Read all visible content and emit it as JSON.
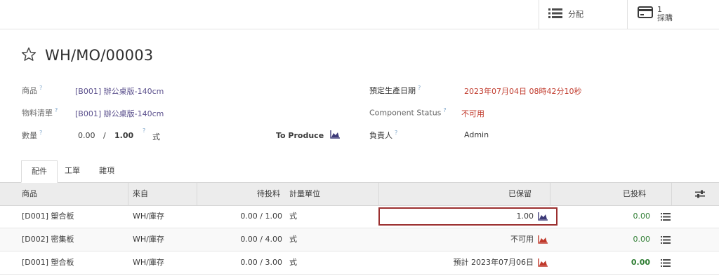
{
  "topbar": {
    "allocation_label": "分配",
    "purchase_count": "1",
    "purchase_label": "採購"
  },
  "record": {
    "title": "WH/MO/00003",
    "product_label": "商品",
    "product_value": "[B001] 辦公桌版-140cm",
    "bom_label": "物料清單",
    "bom_value": "[B001] 辦公桌版-140cm",
    "qty_label": "數量",
    "qty_produced": "0.00",
    "qty_sep": "/",
    "qty_total": "1.00",
    "qty_uom": "式",
    "to_produce_label": "To Produce",
    "scheduled_label": "預定生產日期",
    "scheduled_value": "2023年07月04日 08時42分10秒",
    "component_status_label": "Component Status",
    "component_status_value": "不可用",
    "responsible_label": "負責人",
    "responsible_value": "Admin",
    "help_mark": "?"
  },
  "tabs": [
    "配件",
    "工單",
    "雜項"
  ],
  "table": {
    "headers": {
      "product": "商品",
      "source": "來自",
      "to_consume": "待投料",
      "uom": "計量單位",
      "reserved": "已保留",
      "consumed": "已投料"
    },
    "rows": [
      {
        "product": "[D001] 塑合板",
        "source": "WH/庫存",
        "to_consume": "0.00 /  1.00",
        "uom": "式",
        "reserved": "1.00",
        "consumed": "0.00"
      },
      {
        "product": "[D002] 密集板",
        "source": "WH/庫存",
        "to_consume": "0.00 /  4.00",
        "uom": "式",
        "reserved": "不可用",
        "consumed": "0.00"
      },
      {
        "product": "[D001] 塑合板",
        "source": "WH/庫存",
        "to_consume": "0.00 /  3.00",
        "uom": "式",
        "reserved": "預計 2023年07月06日",
        "consumed": "0.00"
      }
    ]
  },
  "colors": {
    "link": "#5a4f8c",
    "danger": "#c0392b",
    "success": "#2e7d32",
    "header_bg": "#ececec",
    "highlight_border": "#9b2f2f"
  },
  "icons": {
    "allocation": "list-icon",
    "purchase": "credit-card-icon",
    "favorite": "star-outline-icon",
    "forecast": "area-chart-icon",
    "detail": "list-detail-icon",
    "optional_columns": "sliders-icon"
  }
}
